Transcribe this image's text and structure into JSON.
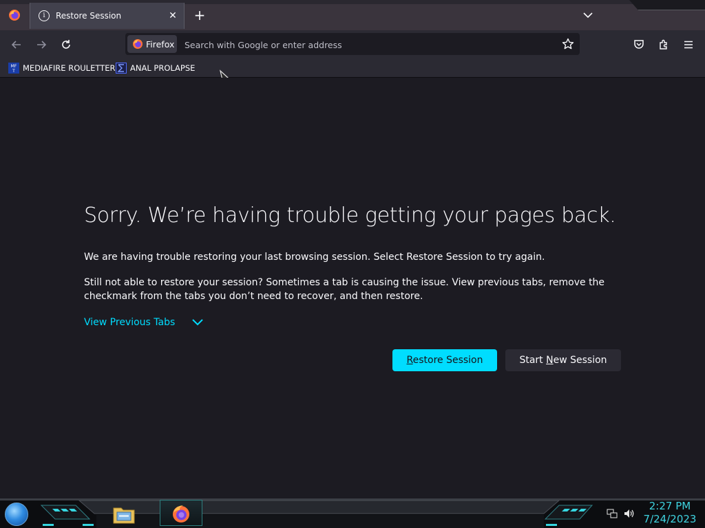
{
  "tab": {
    "title": "Restore Session",
    "close_glyph": "✕",
    "info_glyph": "i"
  },
  "toolbar": {
    "new_tab_glyph": "+",
    "identity_label": "Firefox",
    "url_placeholder": "Search with Google or enter address"
  },
  "bookmarks": [
    {
      "label": "MEDIAFIRE ROULETTER",
      "icon": "mediafire-icon"
    },
    {
      "label": "ANAL PROLAPSE",
      "icon": "sigma-icon"
    }
  ],
  "content": {
    "headline": "Sorry. We’re having trouble getting your pages back.",
    "paragraph1": "We are having trouble restoring your last browsing session. Select Restore Session to try again.",
    "paragraph2": "Still not able to restore your session? Sometimes a tab is causing the issue. View previous tabs, remove the checkmark from the tabs you don’t need to recover, and then restore.",
    "view_previous": "View Previous Tabs",
    "restore_button": {
      "accesskey": "R",
      "rest": "estore Session"
    },
    "new_session_button": {
      "before": "Start ",
      "accesskey": "N",
      "after": "ew Session"
    }
  },
  "taskbar": {
    "time": "2:27 PM",
    "date": "7/24/2023"
  },
  "colors": {
    "accent": "#00ddff",
    "page_bg": "#1c1b22",
    "toolbar_bg": "#2b2a33",
    "clock": "#3fd3e0"
  }
}
